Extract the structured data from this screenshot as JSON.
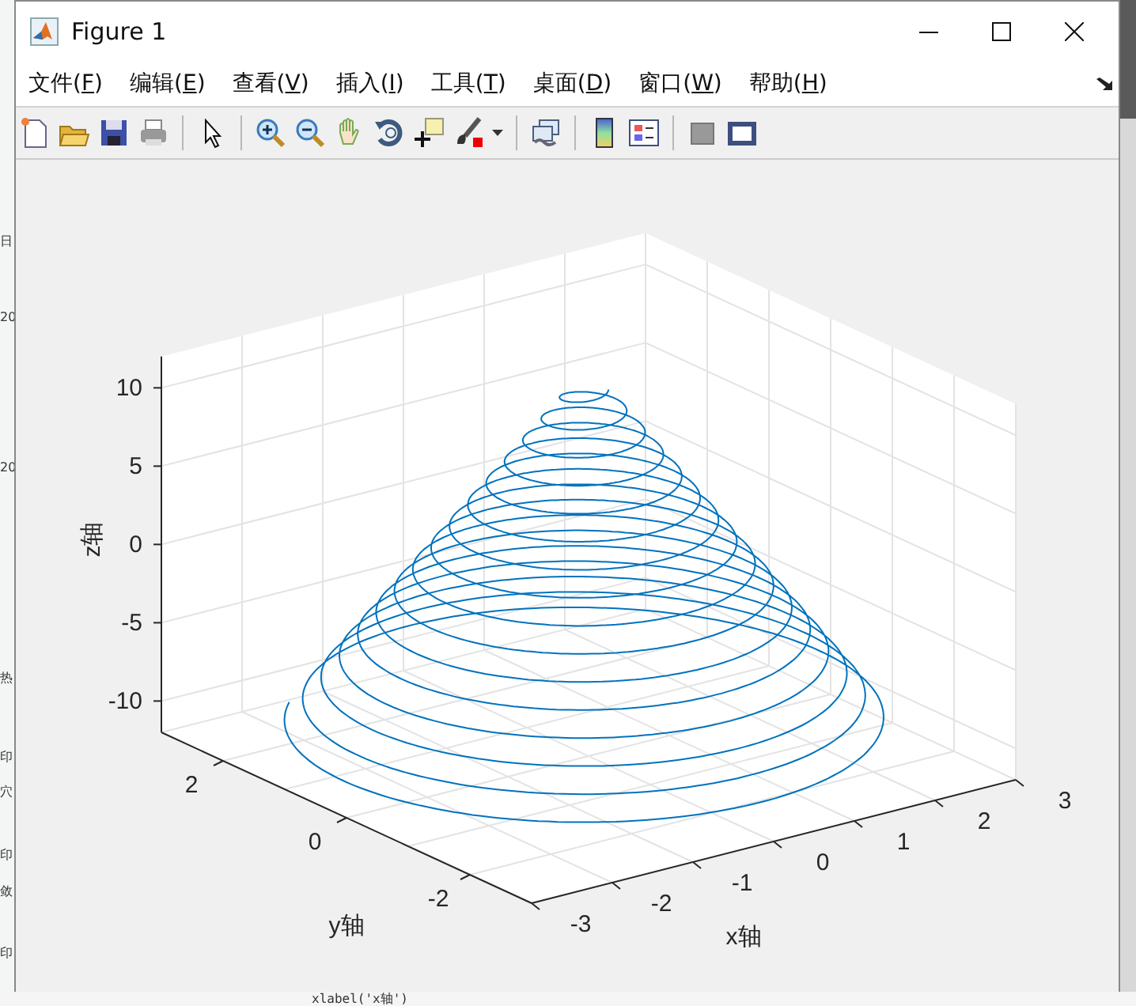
{
  "window": {
    "title": "Figure 1"
  },
  "menu": [
    {
      "prefix": "文件(",
      "key": "F",
      "suffix": ")"
    },
    {
      "prefix": "编辑(",
      "key": "E",
      "suffix": ")"
    },
    {
      "prefix": "查看(",
      "key": "V",
      "suffix": ")"
    },
    {
      "prefix": "插入(",
      "key": "I",
      "suffix": ")"
    },
    {
      "prefix": "工具(",
      "key": "T",
      "suffix": ")"
    },
    {
      "prefix": "桌面(",
      "key": "D",
      "suffix": ")"
    },
    {
      "prefix": "窗口(",
      "key": "W",
      "suffix": ")"
    },
    {
      "prefix": "帮助(",
      "key": "H",
      "suffix": ")"
    }
  ],
  "plot": {
    "z_label": "z轴",
    "y_label": "y轴",
    "x_label": "x轴",
    "z_ticks": [
      "10",
      "5",
      "0",
      "-5",
      "-10"
    ],
    "y_ticks": [
      "2",
      "0",
      "-2"
    ],
    "x_ticks": [
      "-3",
      "-2",
      "-1",
      "0",
      "1",
      "2",
      "3"
    ]
  },
  "background": {
    "side_texts": [
      "日",
      "20",
      "20",
      "热",
      "印",
      "穴",
      "印",
      "敛",
      "印"
    ],
    "code_line": "xlabel('x轴')"
  }
}
